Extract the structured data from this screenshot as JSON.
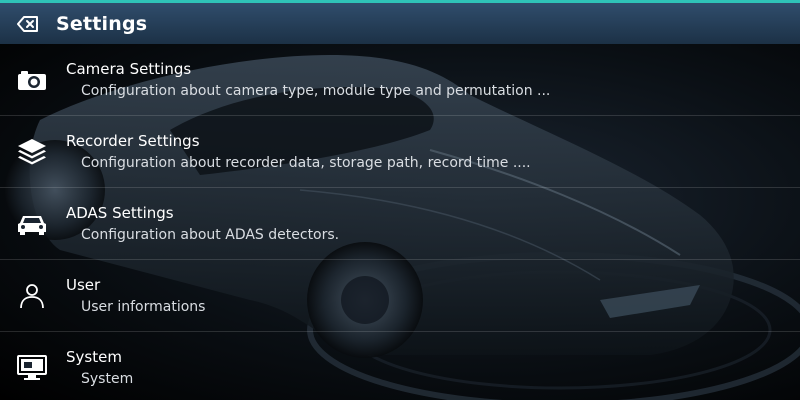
{
  "header": {
    "title": "Settings",
    "back_icon": "backspace-icon",
    "accent_color": "#2fc3b8",
    "bar_color": "#2a4460"
  },
  "items": [
    {
      "icon": "camera-icon",
      "title": "Camera Settings",
      "description": "Configuration about camera type, module type and permutation ..."
    },
    {
      "icon": "layers-icon",
      "title": "Recorder Settings",
      "description": "Configuration about recorder data, storage path, record time ...."
    },
    {
      "icon": "car-icon",
      "title": "ADAS Settings",
      "description": "Configuration about ADAS detectors."
    },
    {
      "icon": "user-icon",
      "title": "User",
      "description": "User informations"
    },
    {
      "icon": "monitor-icon",
      "title": "System",
      "description": "System"
    }
  ]
}
